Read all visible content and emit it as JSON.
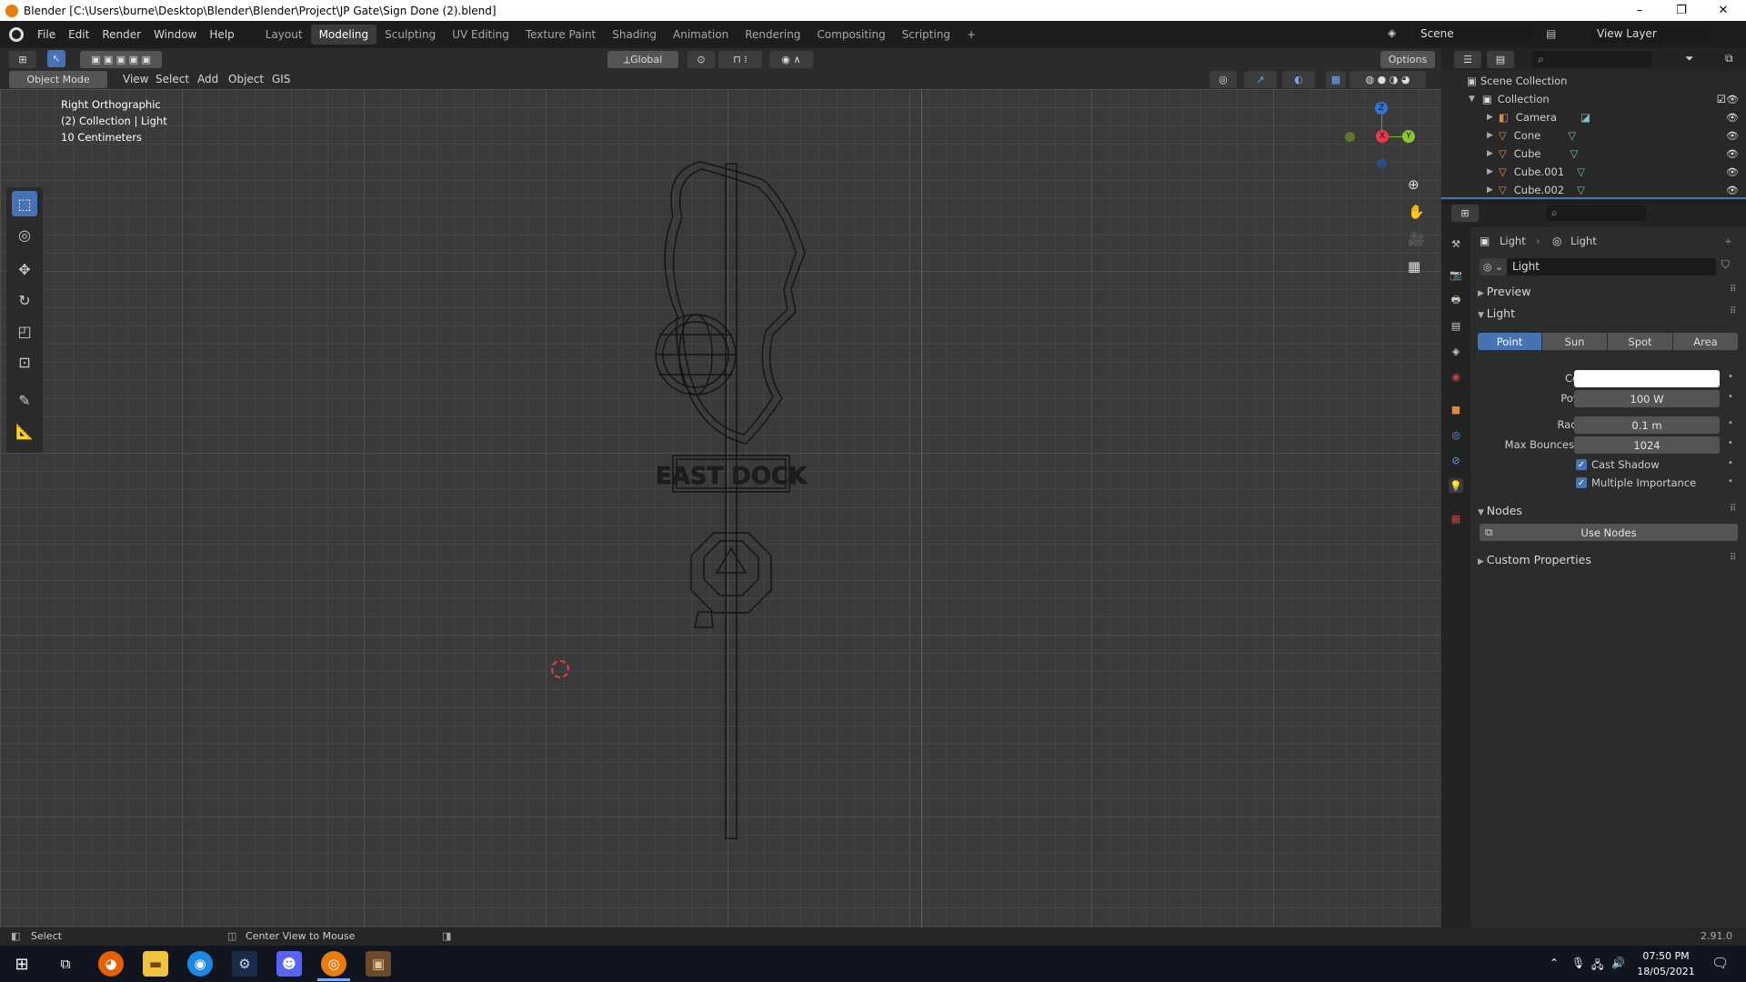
{
  "window": {
    "title": "Blender [C:\\Users\\burne\\Desktop\\Blender\\Blender\\Project\\JP Gate\\Sign Done (2).blend]",
    "controls": [
      "–",
      "❐",
      "✕"
    ]
  },
  "menu": [
    "File",
    "Edit",
    "Render",
    "Window",
    "Help"
  ],
  "workspaces": [
    "Layout",
    "Modeling",
    "Sculpting",
    "UV Editing",
    "Texture Paint",
    "Shading",
    "Animation",
    "Rendering",
    "Compositing",
    "Scripting"
  ],
  "active_workspace": "Modeling",
  "add_tab": "+",
  "scene": {
    "label": "Scene",
    "view_layer": "View Layer"
  },
  "header": {
    "orientation": "Global",
    "options": "Options",
    "mode": "Object Mode",
    "menus": [
      "View",
      "Select",
      "Add",
      "Object",
      "GIS"
    ]
  },
  "viewport": {
    "info": [
      "Right Orthographic",
      "(2) Collection | Light",
      "10 Centimeters"
    ],
    "sign_text": "EAST DOCK"
  },
  "gizmo": {
    "z": "Z",
    "y": "Y",
    "x": "X"
  },
  "outliner": {
    "root": "Scene Collection",
    "collection": "Collection",
    "items": [
      "Camera",
      "Cone",
      "Cube",
      "Cube.001",
      "Cube.002"
    ]
  },
  "properties": {
    "breadcrumb": [
      "Light",
      "Light"
    ],
    "datablock": "Light",
    "panels": {
      "preview": "Preview",
      "light": "Light",
      "nodes": "Nodes",
      "custom": "Custom Properties"
    },
    "light_types": [
      "Point",
      "Sun",
      "Spot",
      "Area"
    ],
    "active_type": "Point",
    "color_label": "Color",
    "color_value": "#ffffff",
    "power_label": "Power",
    "power": "100 W",
    "radius_label": "Radius",
    "radius": "0.1 m",
    "bounces_label": "Max Bounces",
    "bounces": "1024",
    "cast_shadow": "Cast Shadow",
    "multiple_importance": "Multiple Importance",
    "use_nodes": "Use Nodes"
  },
  "status": {
    "left": "Select",
    "middle": "Center View to Mouse",
    "version": "2.91.0"
  },
  "taskbar": {
    "time": "07:50 PM",
    "date": "18/05/2021"
  }
}
